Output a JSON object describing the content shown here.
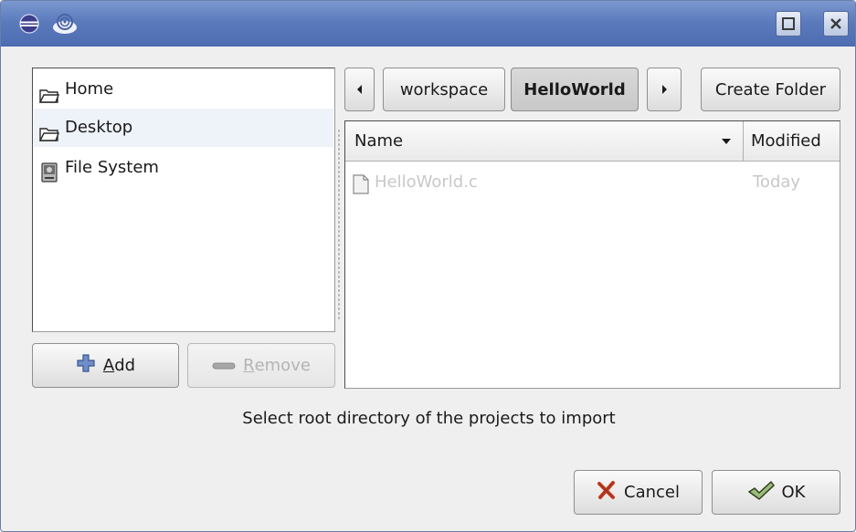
{
  "titlebar": {
    "app_icon": "eclipse-icon",
    "menu_icon": "spiral-icon",
    "maximize_icon": "maximize-icon",
    "close_icon": "close-icon"
  },
  "places": {
    "items": [
      {
        "label": "Home",
        "icon": "folder-open-icon"
      },
      {
        "label": "Desktop",
        "icon": "folder-open-icon"
      },
      {
        "label": "File System",
        "icon": "drive-icon"
      }
    ],
    "add_label": "Add",
    "add_mnemonic": "A",
    "remove_label": "Remove",
    "remove_mnemonic": "R"
  },
  "pathbar": {
    "segments": [
      "workspace",
      "HelloWorld"
    ],
    "active_segment": "HelloWorld",
    "create_folder_label": "Create Folder"
  },
  "filelist": {
    "columns": [
      "Name",
      "Modified"
    ],
    "rows": [
      {
        "name": "HelloWorld.c",
        "modified": "Today"
      }
    ]
  },
  "info_text": "Select root directory of the projects to import",
  "actions": {
    "cancel_label": "Cancel",
    "ok_label": "OK"
  },
  "colors": {
    "titlebar": "#5b7bbd",
    "dialog_bg": "#efefef",
    "selected_row": "#eef2f9"
  }
}
